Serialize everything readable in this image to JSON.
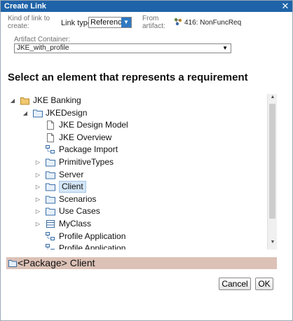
{
  "dialog": {
    "title": "Create Link",
    "close_glyph": "✕"
  },
  "link_kind": {
    "label_line1": "Kind of link to",
    "label_line2": "create:"
  },
  "link_type": {
    "label": "Link type:",
    "value": "References"
  },
  "from_artifact": {
    "label_line1": "From",
    "label_line2": "artifact:",
    "value": "416: NonFuncReq",
    "icon": "requirement-icon"
  },
  "artifact_container": {
    "label": "Artifact Container:",
    "value": "JKE_with_profile"
  },
  "heading": "Select an element that represents a requirement",
  "tree": [
    {
      "label": "JKE Banking",
      "icon": "folder-open-icon",
      "expander": "◢",
      "level": 0
    },
    {
      "label": "JKEDesign",
      "icon": "package-icon",
      "expander": "◢",
      "level": 1
    },
    {
      "label": "JKE Design Model",
      "icon": "document-icon",
      "expander": "",
      "level": 2
    },
    {
      "label": "JKE Overview",
      "icon": "document-icon",
      "expander": "",
      "level": 2
    },
    {
      "label": "Package Import",
      "icon": "package-import-icon",
      "expander": "",
      "level": 2
    },
    {
      "label": "PrimitiveTypes",
      "icon": "package-icon",
      "expander": "▷",
      "level": 2
    },
    {
      "label": "Server",
      "icon": "package-icon",
      "expander": "▷",
      "level": 2
    },
    {
      "label": "Client",
      "icon": "package-icon",
      "expander": "▷",
      "level": 2,
      "selected": true
    },
    {
      "label": "Scenarios",
      "icon": "package-icon",
      "expander": "▷",
      "level": 2
    },
    {
      "label": "Use Cases",
      "icon": "package-icon",
      "expander": "▷",
      "level": 2
    },
    {
      "label": "MyClass",
      "icon": "class-icon",
      "expander": "▷",
      "level": 2
    },
    {
      "label": "Profile Application",
      "icon": "profile-application-icon",
      "expander": "",
      "level": 2
    },
    {
      "label": "Profile Application",
      "icon": "profile-application-icon",
      "expander": "",
      "level": 2
    }
  ],
  "scrollbar": {
    "up": "▲",
    "down": "▼"
  },
  "selection": {
    "text": "<Package> Client",
    "icon": "package-icon"
  },
  "buttons": {
    "cancel": "Cancel",
    "ok": "OK"
  },
  "colors": {
    "titlebar": "#1f63a8",
    "selection_bar": "#dcc1b6",
    "tree_selected": "#d4e6f7",
    "dropdown_button": "#2f79c2"
  }
}
